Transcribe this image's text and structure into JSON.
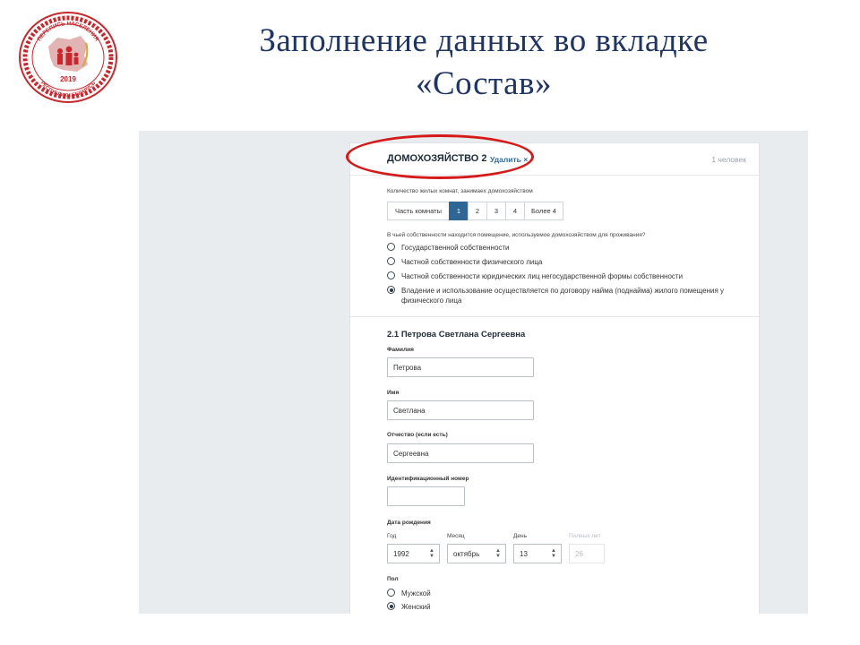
{
  "slide": {
    "title_line1": "Заполнение данных во вкладке",
    "title_line2": "«Состав»",
    "logo": {
      "top_text": "ПЕРЕПИСЬ НАСЕЛЕНИЯ",
      "year": "2019",
      "bottom_text": "РЕСПУБЛИКИ БЕЛАРУСЬ",
      "colors": {
        "ring": "#c8272d",
        "map": "#e2b4b4",
        "accent": "#d9a441"
      }
    }
  },
  "header": {
    "title": "ДОМОХОЗЯЙСТВО 2",
    "delete_label": "Удалить",
    "delete_icon": "×",
    "count": "1 человек"
  },
  "rooms": {
    "label": "Количество жилых комнат, занимаеx домохозяйством",
    "options": [
      "Часть комнаты",
      "1",
      "2",
      "3",
      "4",
      "Более 4"
    ],
    "selected": "1"
  },
  "ownership": {
    "question": "В чьей собственности находится помещение, используемое домохозяйством для проживания?",
    "options": [
      "Государственной собственности",
      "Частной собственности физического лица",
      "Частной собственности юридических лиц негосударственной формы собственности",
      "Владение и использование осуществляется по договору найма (поднайма) жилого помещения у физического лица"
    ],
    "selected_index": 3
  },
  "person": {
    "title": "2.1 Петрова Светлана Сергеевна",
    "surname_label": "Фамилия",
    "surname_value": "Петрова",
    "name_label": "Имя",
    "name_value": "Светлана",
    "patronymic_label": "Отчество (если есть)",
    "patronymic_value": "Сергеевна",
    "id_label": "Идентификационный номер",
    "id_value": "",
    "birth_label": "Дата рождения",
    "year_label": "Год",
    "year_value": "1992",
    "month_label": "Месяц",
    "month_value": "октябрь",
    "day_label": "День",
    "day_value": "13",
    "age_label": "Полных лет",
    "age_value": "26",
    "sex_label": "Пол",
    "sex_options": [
      "Мужской",
      "Женский"
    ],
    "sex_selected": "Женский"
  },
  "colors": {
    "accent": "#2e6696",
    "highlight": "#d51a1a",
    "title": "#1f3566"
  }
}
